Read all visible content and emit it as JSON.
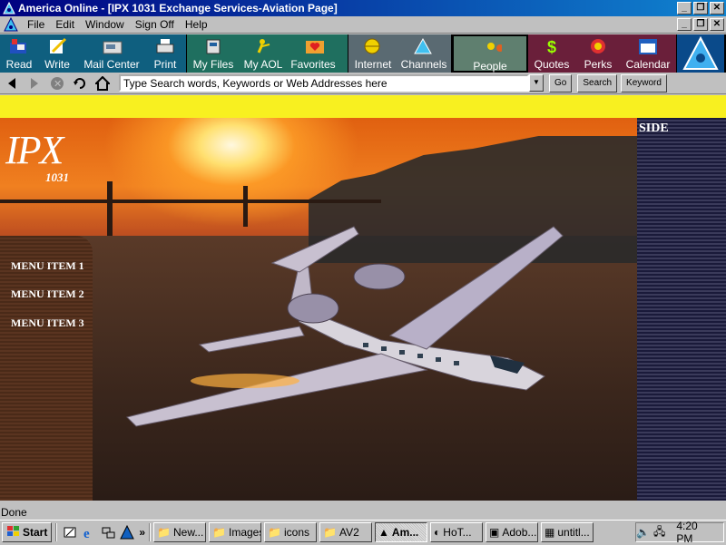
{
  "window": {
    "title": "America  Online - [IPX 1031 Exchange Services-Aviation Page]",
    "controls": {
      "minimize": "_",
      "restore": "❐",
      "close": "✕"
    }
  },
  "menubar": {
    "items": [
      "File",
      "Edit",
      "Window",
      "Sign Off",
      "Help"
    ]
  },
  "toolbar": {
    "buttons": [
      {
        "label": "Read",
        "icon": "mailbox-icon"
      },
      {
        "label": "Write",
        "icon": "pen-paper-icon"
      },
      {
        "label": "Mail Center",
        "icon": "mail-center-icon"
      },
      {
        "label": "Print",
        "icon": "printer-icon"
      },
      {
        "label": "My Files",
        "icon": "files-icon"
      },
      {
        "label": "My AOL",
        "icon": "person-icon"
      },
      {
        "label": "Favorites",
        "icon": "heart-folder-icon"
      },
      {
        "label": "Internet",
        "icon": "globe-icon"
      },
      {
        "label": "Channels",
        "icon": "channels-icon"
      },
      {
        "label": "People",
        "icon": "people-icon"
      },
      {
        "label": "Quotes",
        "icon": "dollar-icon"
      },
      {
        "label": "Perks",
        "icon": "gift-icon"
      },
      {
        "label": "Calendar",
        "icon": "calendar-icon"
      }
    ]
  },
  "navbar": {
    "search_value": "Type Search words, Keywords or Web Addresses here",
    "go_label": "Go",
    "search_label": "Search",
    "keyword_label": "Keyword"
  },
  "page": {
    "logo_text": "IPX",
    "logo_sub": "1031",
    "side_label": "SIDE",
    "menu_items": [
      "MENU ITEM 1",
      "MENU ITEM 2",
      "MENU ITEM 3"
    ]
  },
  "status": {
    "text": "Done"
  },
  "taskbar": {
    "start_label": "Start",
    "tasks": [
      "New...",
      "Images",
      "icons",
      "AV2",
      "Am...",
      "HoT...",
      "Adob...",
      "untitl..."
    ],
    "clock": "4:20 PM"
  },
  "colors": {
    "title_bar": "#000080",
    "yellow_band": "#f8f020",
    "side_panel": "#1a1a3a",
    "left_nav": "#4a2a18"
  }
}
